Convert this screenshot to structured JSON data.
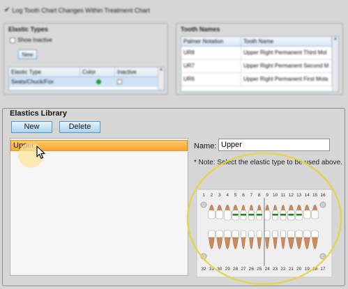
{
  "header": {
    "log_label": "Log Tooth Chart Changes Within Treatment Chart"
  },
  "elastic_types": {
    "title": "Elastic Types",
    "show_inactive_label": "Show Inactive",
    "new_label": "New",
    "columns": [
      "Elastic Type",
      "Color",
      "Inactive"
    ],
    "rows": [
      {
        "type": "Seats/Chuck/Fox",
        "color": "#1f9e1f",
        "inactive": false
      }
    ]
  },
  "tooth_names": {
    "title": "Tooth Names",
    "columns": [
      "Palmer Notation",
      "Tooth Name"
    ],
    "rows": [
      [
        "UR8",
        "Upper Right Permanent Third Mol"
      ],
      [
        "UR7",
        "Upper Right Permanent Second M"
      ],
      [
        "UR6",
        "Upper Right Permanent First Mola"
      ]
    ]
  },
  "library": {
    "title": "Elastics Library",
    "new_label": "New",
    "delete_label": "Delete",
    "items": [
      "Upper"
    ],
    "selected": "Upper",
    "name_label": "Name:",
    "name_value": "Upper",
    "note": "* Note: Select the elastic type to be used above."
  },
  "tooth_chart": {
    "upper_numbers": [
      "1",
      "2",
      "3",
      "4",
      "5",
      "6",
      "7",
      "8",
      "9",
      "10",
      "11",
      "12",
      "13",
      "14",
      "15",
      "16"
    ],
    "lower_numbers": [
      "32",
      "31",
      "30",
      "29",
      "28",
      "27",
      "26",
      "25",
      "24",
      "23",
      "22",
      "21",
      "20",
      "19",
      "18",
      "17"
    ],
    "elastic_color": "#1a8a1a",
    "highlight_color": "#e8d340"
  },
  "colors": {
    "selection": "#f7a930",
    "button_border": "#5c94c4"
  }
}
